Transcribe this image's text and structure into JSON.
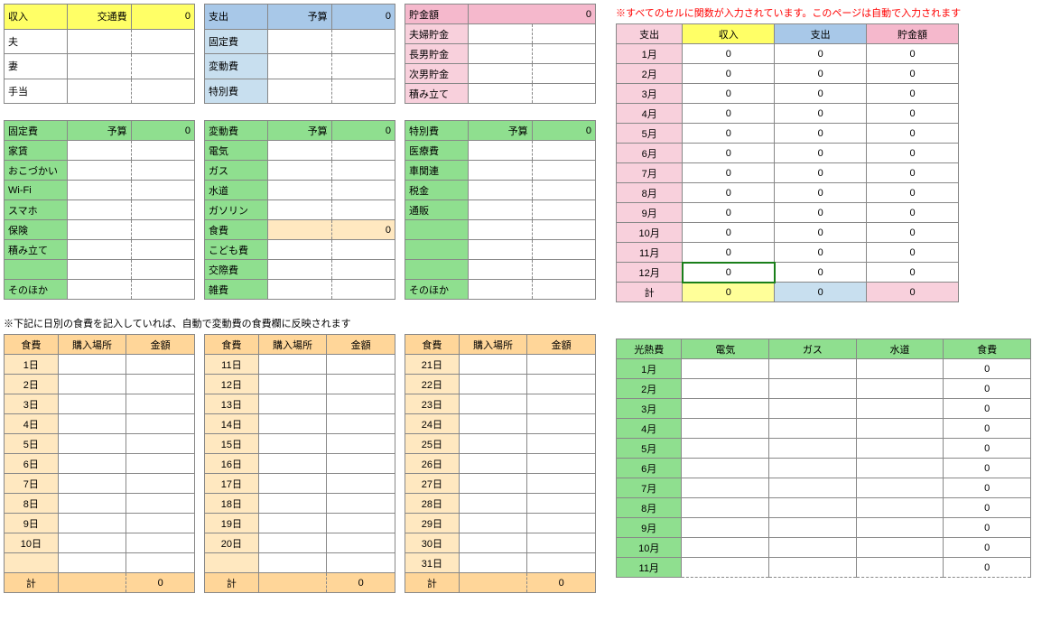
{
  "income": {
    "title": "収入",
    "transport_label": "交通費",
    "transport_value": "0",
    "rows": [
      "夫",
      "妻",
      "手当"
    ]
  },
  "expense": {
    "title": "支出",
    "budget_label": "予算",
    "budget_value": "0",
    "rows": [
      "固定費",
      "変動費",
      "特別費"
    ]
  },
  "savings": {
    "title": "貯金額",
    "value": "0",
    "rows": [
      "夫婦貯金",
      "長男貯金",
      "次男貯金",
      "積み立て"
    ]
  },
  "fixed": {
    "title": "固定費",
    "budget_label": "予算",
    "budget_value": "0",
    "rows": [
      "家賃",
      "おこづかい",
      "Wi-Fi",
      "スマホ",
      "保険",
      "積み立て",
      "",
      "そのほか"
    ]
  },
  "variable": {
    "title": "変動費",
    "budget_label": "予算",
    "budget_value": "0",
    "rows": [
      "電気",
      "ガス",
      "水道",
      "ガソリン",
      "食費",
      "こども費",
      "交際費",
      "雑費"
    ],
    "food_value": "0"
  },
  "special": {
    "title": "特別費",
    "budget_label": "予算",
    "budget_value": "0",
    "rows": [
      "医療費",
      "車関連",
      "税金",
      "通販",
      "",
      "",
      "",
      "そのほか"
    ]
  },
  "food_note": "※下記に日別の食費を記入していれば、自動で変動費の食費欄に反映されます",
  "food_header": {
    "title": "食費",
    "place": "購入場所",
    "amount": "金額",
    "total": "計",
    "total_value": "0"
  },
  "food_days1": [
    "1日",
    "2日",
    "3日",
    "4日",
    "5日",
    "6日",
    "7日",
    "8日",
    "9日",
    "10日"
  ],
  "food_days2": [
    "11日",
    "12日",
    "13日",
    "14日",
    "15日",
    "16日",
    "17日",
    "18日",
    "19日",
    "20日"
  ],
  "food_days3": [
    "21日",
    "22日",
    "23日",
    "24日",
    "25日",
    "26日",
    "27日",
    "28日",
    "29日",
    "30日",
    "31日"
  ],
  "right_note": "※すべてのセルに関数が入力されています。このページは自動で入力されます",
  "summary": {
    "headers": [
      "支出",
      "収入",
      "支出",
      "貯金額"
    ],
    "months": [
      "1月",
      "2月",
      "3月",
      "4月",
      "5月",
      "6月",
      "7月",
      "8月",
      "9月",
      "10月",
      "11月",
      "12月"
    ],
    "total_label": "計",
    "zero": "0"
  },
  "utility": {
    "headers": [
      "光熱費",
      "電気",
      "ガス",
      "水道",
      "食費"
    ],
    "months": [
      "1月",
      "2月",
      "3月",
      "4月",
      "5月",
      "6月",
      "7月",
      "8月",
      "9月",
      "10月",
      "11月"
    ],
    "zero": "0"
  }
}
